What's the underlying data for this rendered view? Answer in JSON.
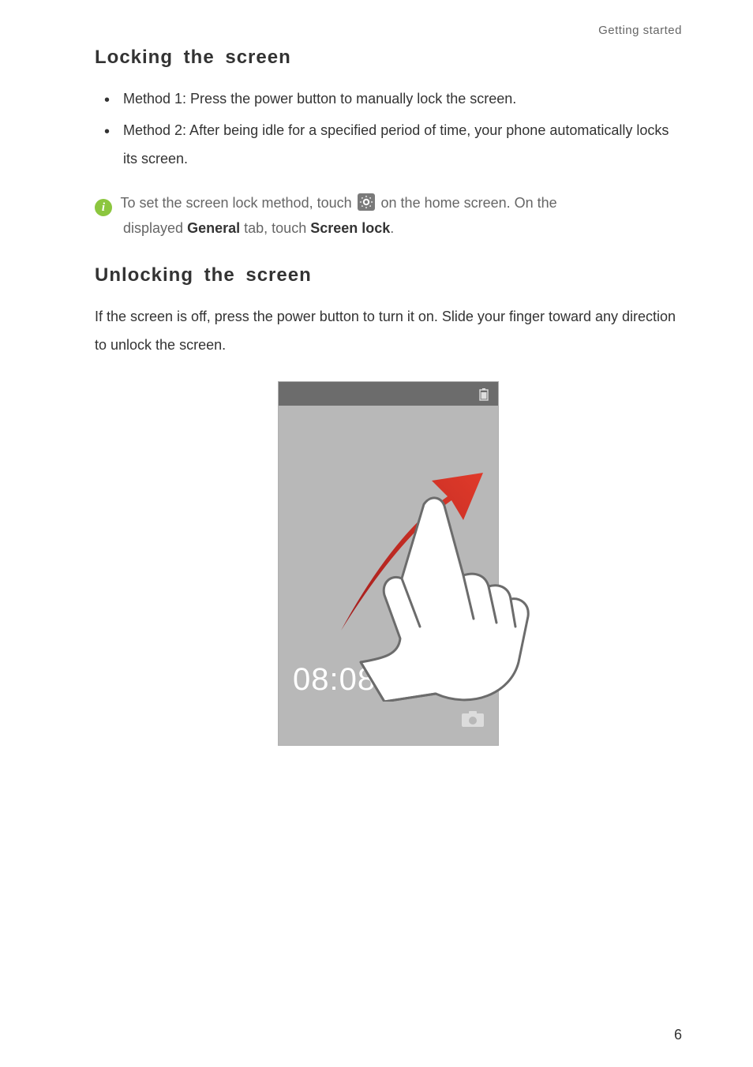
{
  "header": {
    "running": "Getting started"
  },
  "sections": {
    "locking": {
      "heading": "Locking the screen",
      "bullets": [
        "Method 1: Press the power button to manually lock the screen.",
        "Method 2: After being idle for a specified period of time, your phone automatically locks its screen."
      ],
      "info_pre": "To set the screen lock method, touch",
      "info_post": "on the home screen. On the",
      "info_line2a": "displayed",
      "info_general": "General",
      "info_tab": "tab, touch",
      "info_screen_lock": "Screen lock",
      "info_period": "."
    },
    "unlocking": {
      "heading": "Unlocking the screen",
      "body": "If the screen is off, press the power button to turn it on. Slide your finger toward any direction to unlock the screen."
    }
  },
  "illustration": {
    "clock": "08:08"
  },
  "icons": {
    "info": "i",
    "settings": "settings-gear-icon",
    "battery": "battery-icon",
    "camera": "camera-icon"
  },
  "page_number": "6"
}
